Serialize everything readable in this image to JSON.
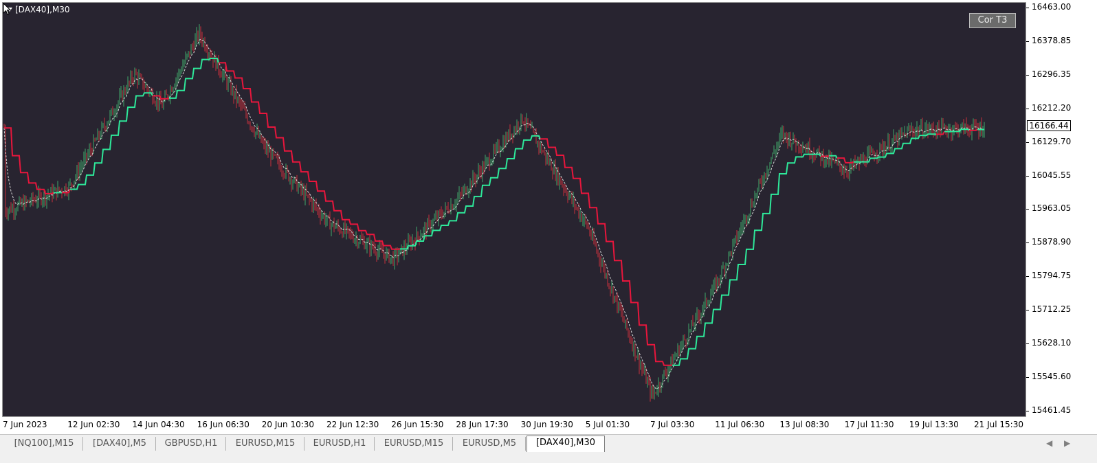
{
  "window": {
    "symbol_label": "[DAX40],M30"
  },
  "indicator_button": {
    "label": "Cor T3"
  },
  "price_axis": {
    "ticks": [
      "16463.00",
      "16378.85",
      "16296.35",
      "16212.20",
      "16129.70",
      "16045.55",
      "15963.05",
      "15878.90",
      "15794.75",
      "15712.25",
      "15628.10",
      "15545.60",
      "15461.45"
    ],
    "current_price": "16166.44"
  },
  "time_axis": {
    "ticks": [
      "7 Jun 2023",
      "12 Jun 02:30",
      "14 Jun 04:30",
      "16 Jun 06:30",
      "20 Jun 10:30",
      "22 Jun 12:30",
      "26 Jun 15:30",
      "28 Jun 17:30",
      "30 Jun 19:30",
      "5 Jul 01:30",
      "7 Jul 03:30",
      "11 Jul 06:30",
      "13 Jul 08:30",
      "17 Jul 11:30",
      "19 Jul 13:30",
      "21 Jul 15:30"
    ]
  },
  "tabs": [
    {
      "label": "[NQ100],M15",
      "active": false
    },
    {
      "label": "[DAX40],M5",
      "active": false
    },
    {
      "label": "GBPUSD,H1",
      "active": false
    },
    {
      "label": "EURUSD,M15",
      "active": false
    },
    {
      "label": "EURUSD,H1",
      "active": false
    },
    {
      "label": "EURUSD,M15",
      "active": false
    },
    {
      "label": "EURUSD,M5",
      "active": false
    },
    {
      "label": "[DAX40],M30",
      "active": true
    }
  ],
  "colors": {
    "background": "#282430",
    "bull_line": "#2ee89a",
    "bear_line": "#e8163c",
    "candle_up": "#3fa86a",
    "candle_down": "#c8303c",
    "signal_dashed": "#d8d8d8"
  },
  "chart_data": {
    "type": "candlestick",
    "ylim": [
      15461.45,
      16463.0
    ],
    "price_path": [
      [
        "7 Jun 2023",
        15960
      ],
      [
        "12 Jun 02:30",
        16020
      ],
      [
        "14 Jun 04:30",
        16300
      ],
      [
        "14 Jun 04:30",
        16220
      ],
      [
        "16 Jun 06:30",
        16400
      ],
      [
        "20 Jun 10:30",
        16120
      ],
      [
        "22 Jun 12:30",
        15930
      ],
      [
        "26 Jun 15:30",
        15840
      ],
      [
        "28 Jun 17:30",
        15990
      ],
      [
        "30 Jun 19:30",
        16190
      ],
      [
        "5 Jul 01:30",
        15920
      ],
      [
        "7 Jul 03:30",
        15500
      ],
      [
        "11 Jul 06:30",
        15780
      ],
      [
        "13 Jul 08:30",
        16150
      ],
      [
        "17 Jul 11:30",
        16060
      ],
      [
        "19 Jul 13:30",
        16160
      ],
      [
        "21 Jul 15:30",
        16166
      ]
    ]
  }
}
